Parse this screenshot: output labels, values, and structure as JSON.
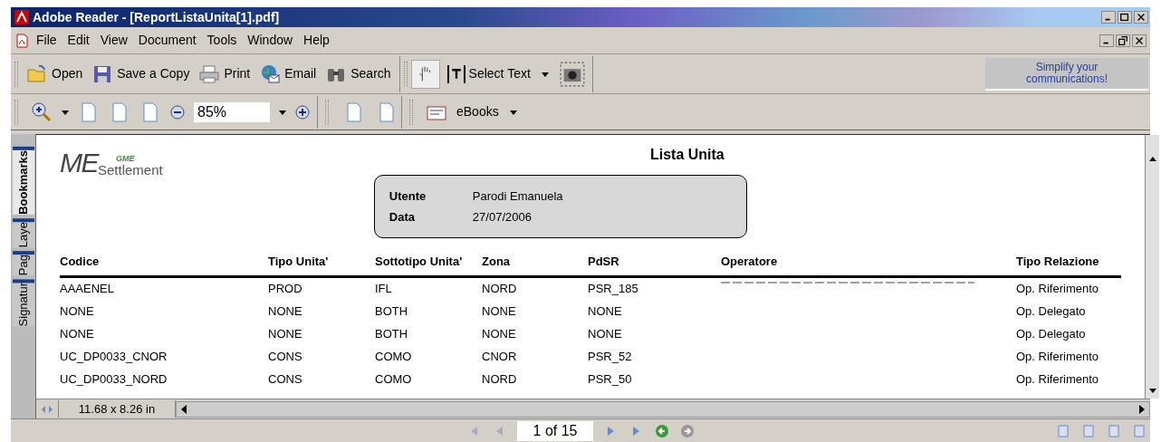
{
  "window": {
    "title": "Adobe Reader - [ReportListaUnita[1].pdf]"
  },
  "menu": [
    "File",
    "Edit",
    "View",
    "Document",
    "Tools",
    "Window",
    "Help"
  ],
  "toolbar": [
    {
      "kind": "open",
      "label": "Open"
    },
    {
      "kind": "save",
      "label": "Save a Copy"
    },
    {
      "kind": "print",
      "label": "Print"
    },
    {
      "kind": "email",
      "label": "Email"
    },
    {
      "kind": "search",
      "label": "Search"
    }
  ],
  "select_tool": {
    "label": "Select Text"
  },
  "promo": {
    "text": "Simplify your communications!"
  },
  "zoom": {
    "value": "85%"
  },
  "ebooks": {
    "label": "eBooks"
  },
  "side_tabs": [
    {
      "label": "Bookmarks",
      "selected": true
    },
    {
      "label": "Laye",
      "selected": false
    },
    {
      "label": "Pag",
      "selected": false
    },
    {
      "label": "Signatur",
      "selected": false
    }
  ],
  "document": {
    "logo": {
      "main": "ME",
      "sub": "Settlement",
      "badge": "GME"
    },
    "title": "Lista Unita",
    "info": [
      {
        "label": "Utente",
        "value": "Parodi Emanuela"
      },
      {
        "label": "Data",
        "value": "27/07/2006"
      }
    ],
    "table": {
      "columns": [
        "Codice",
        "Tipo Unita'",
        "Sottotipo Unita'",
        "Zona",
        "PdSR",
        "Operatore",
        "Tipo Relazione"
      ],
      "rows": [
        [
          "AAAENEL",
          "PROD",
          "IFL",
          "NORD",
          "PSR_185",
          null,
          "Op. Riferimento"
        ],
        [
          "NONE",
          "NONE",
          "BOTH",
          "NONE",
          "NONE",
          null,
          "Op. Delegato"
        ],
        [
          "NONE",
          "NONE",
          "BOTH",
          "NONE",
          "NONE",
          null,
          "Op. Delegato"
        ],
        [
          "UC_DP0033_CNOR",
          "CONS",
          "COMO",
          "CNOR",
          "PSR_52",
          null,
          "Op. Riferimento"
        ],
        [
          "UC_DP0033_NORD",
          "CONS",
          "COMO",
          "NORD",
          "PSR_50",
          null,
          "Op. Riferimento"
        ]
      ]
    }
  },
  "page_size": "11.68 x 8.26 in",
  "page_field": {
    "value": "1 of 15"
  }
}
